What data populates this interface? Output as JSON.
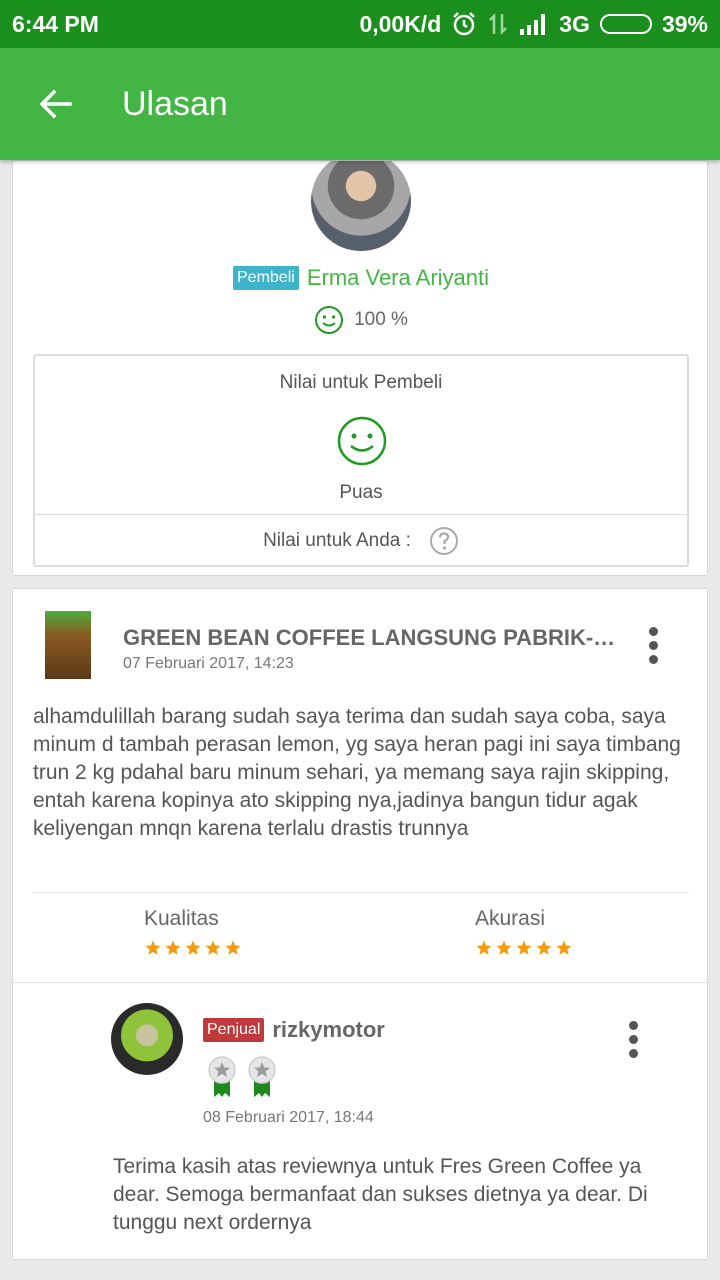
{
  "status_bar": {
    "time": "6:44 PM",
    "speed": "0,00K/d",
    "network": "3G",
    "battery_text": "39%",
    "battery_level": 0.39
  },
  "app_bar": {
    "title": "Ulasan",
    "back_icon": "arrow-left-icon"
  },
  "buyer": {
    "tag": "Pembeli",
    "name": "Erma Vera Ariyanti",
    "satisfaction": "100 %"
  },
  "rating_box": {
    "title": "Nilai untuk Pembeli",
    "result": "Puas",
    "for_you_label": "Nilai untuk Anda :"
  },
  "product": {
    "title": "GREEN BEAN COFFEE LANGSUNG PABRIK-J...",
    "date": "07 Februari 2017, 14:23",
    "review": "alhamdulillah barang sudah saya terima dan sudah saya coba, saya minum d tambah perasan lemon, yg saya heran pagi ini saya timbang trun 2 kg pdahal baru minum sehari, ya memang saya rajin skipping, entah karena kopinya ato skipping nya,jadinya bangun tidur agak keliyengan mnqn karena terlalu drastis trunnya"
  },
  "metrics": {
    "quality": {
      "label": "Kualitas",
      "stars": 5
    },
    "accuracy": {
      "label": "Akurasi",
      "stars": 5
    }
  },
  "seller_reply": {
    "tag": "Penjual",
    "name": "rizkymotor",
    "medals": 2,
    "date": "08 Februari 2017, 18:44",
    "text": "Terima kasih atas reviewnya untuk Fres Green Coffee ya dear. Semoga bermanfaat dan sukses dietnya ya dear. Di tunggu next ordernya"
  },
  "colors": {
    "status_bar": "#1b8f1e",
    "app_bar": "#43b544",
    "buyer_tag": "#3fb3c9",
    "seller_tag": "#c0393b",
    "star": "#f39c12"
  }
}
